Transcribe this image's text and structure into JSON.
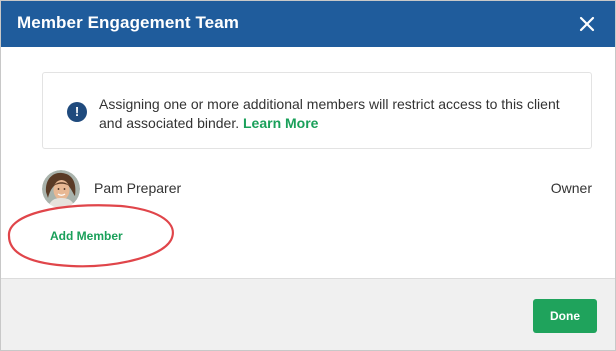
{
  "dialog": {
    "title": "Member Engagement Team",
    "close_icon": "close-icon"
  },
  "notice": {
    "icon": "info-icon",
    "icon_glyph": "!",
    "text": "Assigning one or more additional members will restrict access to this client and associated binder.",
    "link_label": "Learn More"
  },
  "members": [
    {
      "name": "Pam Preparer",
      "role": "Owner",
      "avatar": "avatar"
    }
  ],
  "add_member_label": "Add Member",
  "footer": {
    "done_label": "Done"
  },
  "colors": {
    "header": "#1f5c9c",
    "accent_green": "#1fa35c",
    "link_green": "#1aa05a",
    "info_icon": "#1f4a7d",
    "annotation_red": "#e0454a"
  }
}
